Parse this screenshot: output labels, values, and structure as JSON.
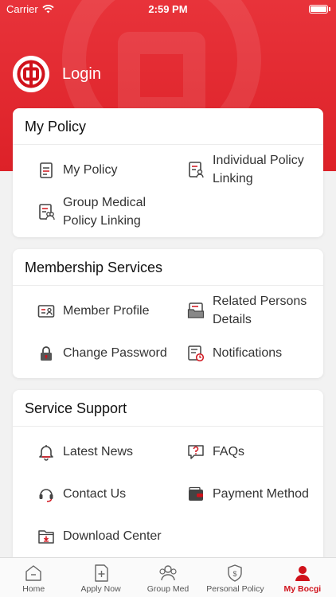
{
  "status_bar": {
    "carrier": "Carrier",
    "time": "2:59 PM"
  },
  "header": {
    "login_label": "Login"
  },
  "sections": {
    "my_policy": {
      "title": "My Policy",
      "items": {
        "my_policy": "My Policy",
        "individual_policy_linking": "Individual Policy Linking",
        "group_medical_policy_linking": "Group Medical Policy Linking"
      }
    },
    "membership": {
      "title": "Membership Services",
      "items": {
        "member_profile": "Member Profile",
        "related_persons": "Related Persons Details",
        "change_password": "Change Password",
        "notifications": "Notifications"
      }
    },
    "support": {
      "title": "Service Support",
      "items": {
        "latest_news": "Latest News",
        "faqs": "FAQs",
        "contact_us": "Contact Us",
        "payment_method": "Payment Method",
        "download_center": "Download Center"
      }
    }
  },
  "tabbar": {
    "home": "Home",
    "apply_now": "Apply Now",
    "group_med": "Group Med",
    "personal_policy": "Personal Policy",
    "my_bocgi": "My Bocgi"
  },
  "colors": {
    "brand_red": "#dd2128",
    "icon_gray": "#444444"
  }
}
